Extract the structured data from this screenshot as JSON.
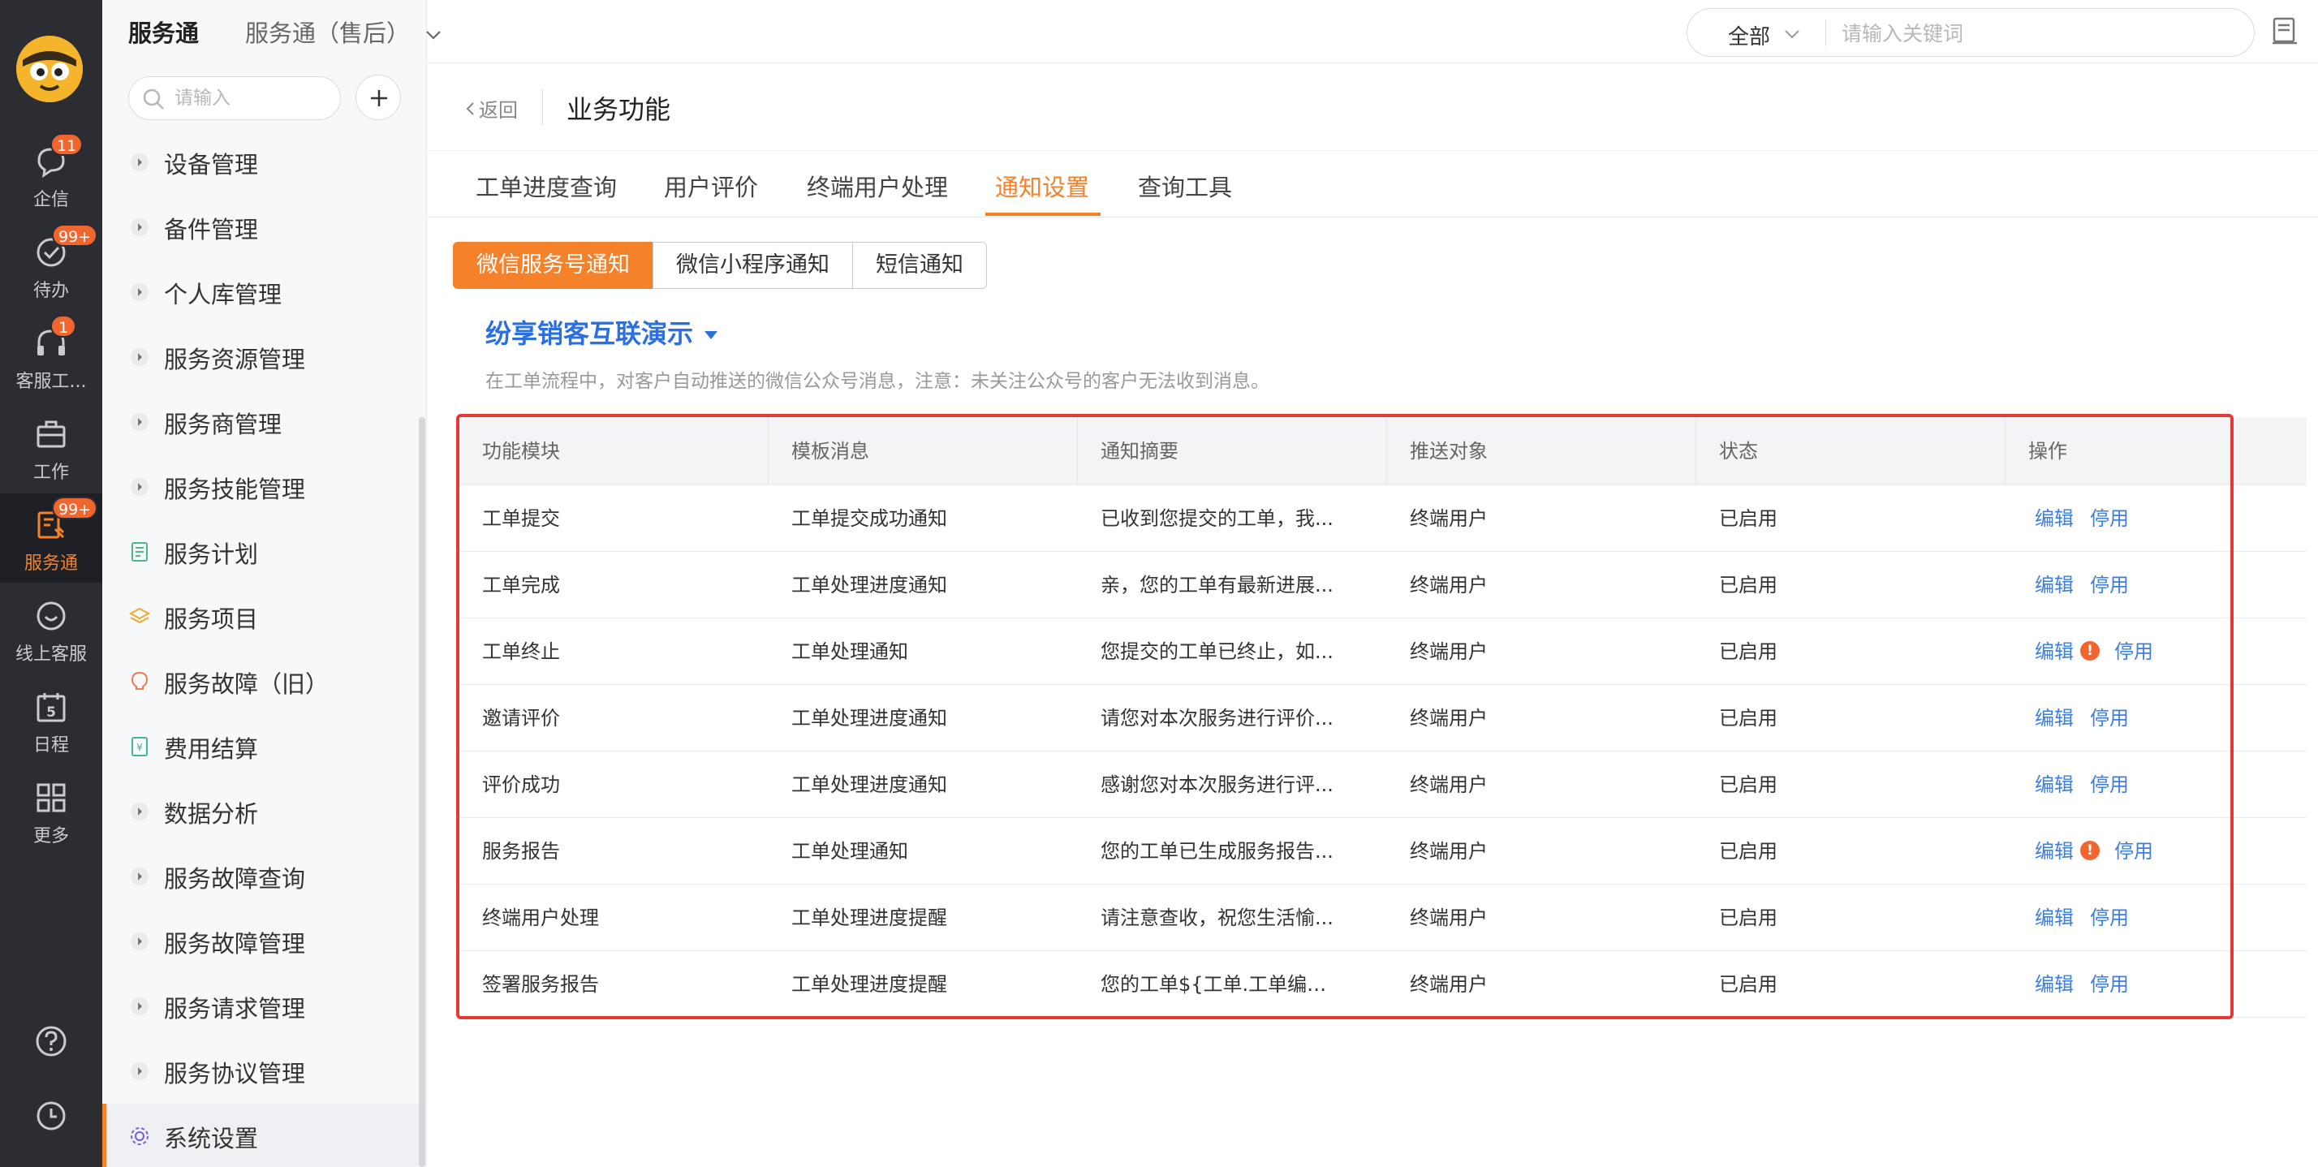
{
  "rail": {
    "items": [
      {
        "label": "企信",
        "badge": "11"
      },
      {
        "label": "待办",
        "badge": "99+"
      },
      {
        "label": "客服工...",
        "badge": "1"
      },
      {
        "label": "工作",
        "badge": ""
      },
      {
        "label": "服务通",
        "badge": "99+"
      },
      {
        "label": "线上客服",
        "badge": ""
      },
      {
        "label": "日程",
        "badge": "",
        "day": "5"
      },
      {
        "label": "更多",
        "badge": ""
      }
    ],
    "accent": "#f5812b"
  },
  "menu": {
    "brand": "服务通",
    "app_name": "服务通（售后）",
    "search_placeholder": "请输入",
    "items": [
      {
        "label": "设备管理"
      },
      {
        "label": "备件管理"
      },
      {
        "label": "个人库管理"
      },
      {
        "label": "服务资源管理"
      },
      {
        "label": "服务商管理"
      },
      {
        "label": "服务技能管理"
      },
      {
        "label": "服务计划"
      },
      {
        "label": "服务项目"
      },
      {
        "label": "服务故障（旧）"
      },
      {
        "label": "费用结算"
      },
      {
        "label": "数据分析"
      },
      {
        "label": "服务故障查询"
      },
      {
        "label": "服务故障管理"
      },
      {
        "label": "服务请求管理"
      },
      {
        "label": "服务协议管理"
      },
      {
        "label": "系统设置"
      }
    ]
  },
  "topbar": {
    "scope": "全部",
    "search_placeholder": "请输入关键词"
  },
  "page": {
    "back_label": "返回",
    "title": "业务功能",
    "tabs": [
      "工单进度查询",
      "用户评价",
      "终端用户处理",
      "通知设置",
      "查询工具"
    ],
    "active_tab": "通知设置",
    "channels": [
      "微信服务号通知",
      "微信小程序通知",
      "短信通知"
    ],
    "active_channel": "微信服务号通知",
    "account": "纷享销客互联演示",
    "tip": "在工单流程中，对客户自动推送的微信公众号消息，注意：未关注公众号的客户无法收到消息。"
  },
  "table": {
    "columns": [
      "功能模块",
      "模板消息",
      "通知摘要",
      "推送对象",
      "状态",
      "操作"
    ],
    "rows": [
      {
        "module": "工单提交",
        "template": "工单提交成功通知",
        "summary": "已收到您提交的工单，我...",
        "target": "终端用户",
        "status": "已启用",
        "edit": "编辑",
        "disable": "停用",
        "warning": false
      },
      {
        "module": "工单完成",
        "template": "工单处理进度通知",
        "summary": "亲，您的工单有最新进展...",
        "target": "终端用户",
        "status": "已启用",
        "edit": "编辑",
        "disable": "停用",
        "warning": false
      },
      {
        "module": "工单终止",
        "template": "工单处理通知",
        "summary": "您提交的工单已终止，如...",
        "target": "终端用户",
        "status": "已启用",
        "edit": "编辑",
        "disable": "停用",
        "warning": true
      },
      {
        "module": "邀请评价",
        "template": "工单处理进度通知",
        "summary": "请您对本次服务进行评价...",
        "target": "终端用户",
        "status": "已启用",
        "edit": "编辑",
        "disable": "停用",
        "warning": false
      },
      {
        "module": "评价成功",
        "template": "工单处理进度通知",
        "summary": "感谢您对本次服务进行评...",
        "target": "终端用户",
        "status": "已启用",
        "edit": "编辑",
        "disable": "停用",
        "warning": false
      },
      {
        "module": "服务报告",
        "template": "工单处理通知",
        "summary": "您的工单已生成服务报告...",
        "target": "终端用户",
        "status": "已启用",
        "edit": "编辑",
        "disable": "停用",
        "warning": true
      },
      {
        "module": "终端用户处理",
        "template": "工单处理进度提醒",
        "summary": "请注意查收，祝您生活愉...",
        "target": "终端用户",
        "status": "已启用",
        "edit": "编辑",
        "disable": "停用",
        "warning": false
      },
      {
        "module": "签署服务报告",
        "template": "工单处理进度提醒",
        "summary": "您的工单${工单.工单编号}...",
        "target": "终端用户",
        "status": "已启用",
        "edit": "编辑",
        "disable": "停用",
        "warning": false
      }
    ],
    "warning_glyph": "!",
    "highlight_color": "#e53935",
    "link_color": "#3d7ee6"
  }
}
